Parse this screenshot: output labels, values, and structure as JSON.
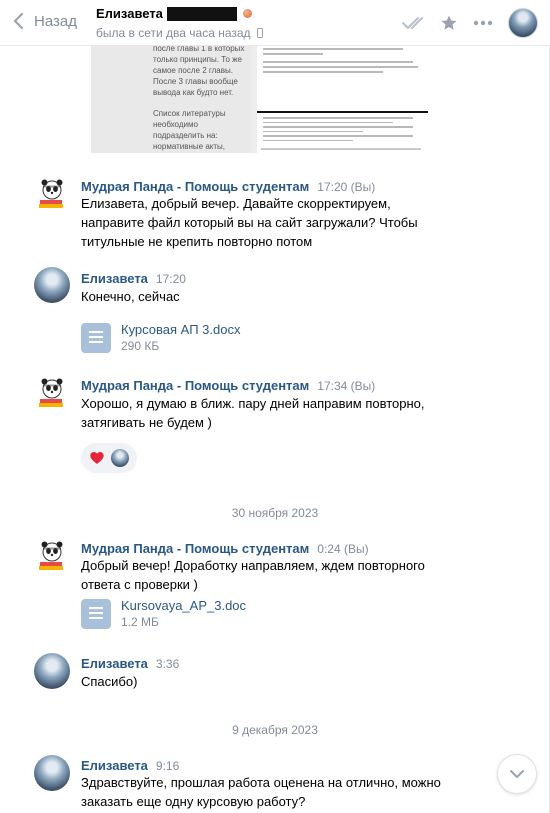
{
  "header": {
    "back_label": "Назад",
    "contact_name": "Елизавета",
    "status": "была в сети два часа назад"
  },
  "doc_preview": {
    "left_text_1": "после главы 1 в которых\nтолько принципы. То же\nсамое после 2 главы.\nПосле 3 главы вообще\nвывода как будто нет.",
    "left_text_2": "Список литературы\nнеобходимо\nподразделить на:\nнормативные акты,\nучебная литература,\nсудебная практика"
  },
  "messages": [
    {
      "author": "Мудрая Панда - Помощь студентам",
      "time": "17:20 (Вы)",
      "text": "Елизавета, добрый вечер. Давайте скорректируем, направите файл который вы на сайт загружали? Чтобы титульные не крепить повторно потом"
    },
    {
      "author": "Елизавета",
      "time": "17:20",
      "text": "Конечно, сейчас",
      "file": {
        "name": "Курсовая АП 3.docx",
        "size": "290 КБ"
      }
    },
    {
      "author": "Мудрая Панда - Помощь студентам",
      "time": "17:34 (Вы)",
      "text": "Хорошо, я думаю в ближ. пару дней направим повторно, затягивать не будем )"
    },
    {
      "author": "Мудрая Панда - Помощь студентам",
      "time": "0:24 (Вы)",
      "text": "Добрый вечер! Доработку направляем, ждем повторного ответа с проверки )",
      "file": {
        "name": "Kursovaya_AP_3.doc",
        "size": "1.2 МБ"
      }
    },
    {
      "author": "Елизавета",
      "time": "3:36",
      "text": "Спасибо)"
    },
    {
      "author": "Елизавета",
      "time": "9:16",
      "text": "Здравствуйте, прошлая работа оценена на отлично, можно заказать еще одну курсовую работу?"
    }
  ],
  "date_separators": [
    "30 ноября 2023",
    "9 декабря 2023"
  ],
  "icons": {
    "back": "chevron-left-icon",
    "read": "double-check-icon",
    "favorite": "star-icon",
    "more": "ellipsis-icon",
    "scroll": "chevron-down-icon",
    "reaction": "heart-icon"
  },
  "colors": {
    "link": "#2a5885",
    "muted": "#818c99",
    "file_icon": "#a9c0da"
  }
}
